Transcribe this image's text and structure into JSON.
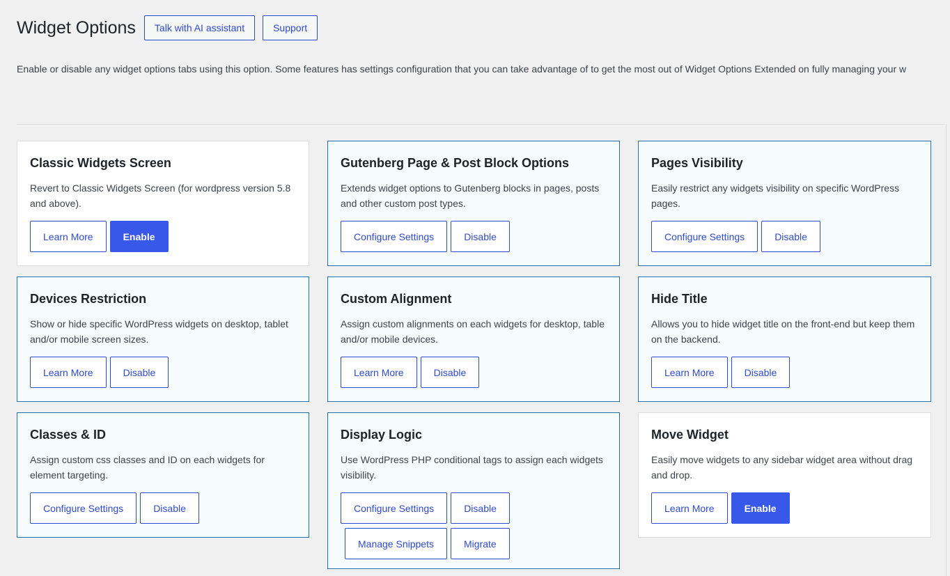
{
  "header": {
    "title": "Widget Options",
    "ai_button": "Talk with AI assistant",
    "support_button": "Support"
  },
  "description": "Enable or disable any widget options tabs using this option. Some features has settings configuration that you can take advantage of to get the most out of Widget Options Extended on fully managing your w",
  "colors": {
    "accent": "#2e4ad1",
    "primary_button": "#3858e9",
    "active_card_border": "#2271b1",
    "active_card_bg": "#f6fbfd",
    "page_bg": "#f0f0f1"
  },
  "cards": [
    {
      "title": "Classic Widgets Screen",
      "description": "Revert to Classic Widgets Screen (for wordpress version 5.8 and above).",
      "state": "inactive",
      "buttons": [
        "Learn More",
        "Enable"
      ]
    },
    {
      "title": "Gutenberg Page & Post Block Options",
      "description": "Extends widget options to Gutenberg blocks in pages, posts and other custom post types.",
      "state": "active",
      "buttons": [
        "Configure Settings",
        "Disable"
      ]
    },
    {
      "title": "Pages Visibility",
      "description": "Easily restrict any widgets visibility on specific WordPress pages.",
      "state": "active",
      "buttons": [
        "Configure Settings",
        "Disable"
      ]
    },
    {
      "title": "Devices Restriction",
      "description": "Show or hide specific WordPress widgets on desktop, tablet and/or mobile screen sizes.",
      "state": "active",
      "buttons": [
        "Learn More",
        "Disable"
      ]
    },
    {
      "title": "Custom Alignment",
      "description": "Assign custom alignments on each widgets for desktop, table and/or mobile devices.",
      "state": "active",
      "buttons": [
        "Learn More",
        "Disable"
      ]
    },
    {
      "title": "Hide Title",
      "description": "Allows you to hide widget title on the front-end but keep them on the backend.",
      "state": "active",
      "buttons": [
        "Learn More",
        "Disable"
      ]
    },
    {
      "title": "Classes & ID",
      "description": "Assign custom css classes and ID on each widgets for element targeting.",
      "state": "active",
      "buttons": [
        "Configure Settings",
        "Disable"
      ]
    },
    {
      "title": "Display Logic",
      "description": "Use WordPress PHP conditional tags to assign each widgets visibility.",
      "state": "active",
      "buttons": [
        "Configure Settings",
        "Disable",
        "Manage Snippets",
        "Migrate"
      ]
    },
    {
      "title": "Move Widget",
      "description": "Easily move widgets to any sidebar widget area without drag and drop.",
      "state": "inactive",
      "buttons": [
        "Learn More",
        "Enable"
      ]
    }
  ]
}
